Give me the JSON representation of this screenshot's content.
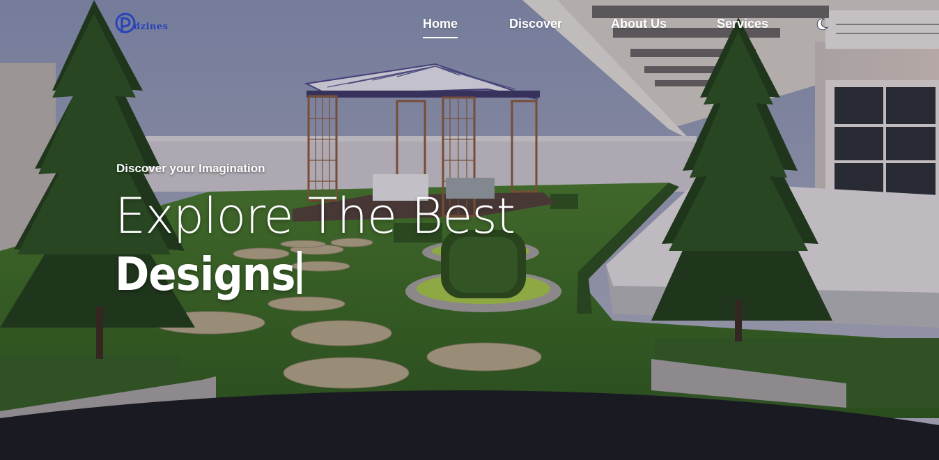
{
  "brand": {
    "logo_letter": "D",
    "logo_text": "dzines",
    "logo_color": "#2743b8"
  },
  "nav": {
    "items": [
      {
        "label": "Home",
        "active": true
      },
      {
        "label": "Discover",
        "active": false
      },
      {
        "label": "About Us",
        "active": false
      },
      {
        "label": "Services",
        "active": false
      }
    ],
    "theme_toggle_icon": "moon-icon"
  },
  "hero": {
    "eyebrow": "Discover your Imagination",
    "headline_line1": "Explore The Best",
    "headline_line2": "Designs",
    "background": "garden-gazebo-render"
  }
}
